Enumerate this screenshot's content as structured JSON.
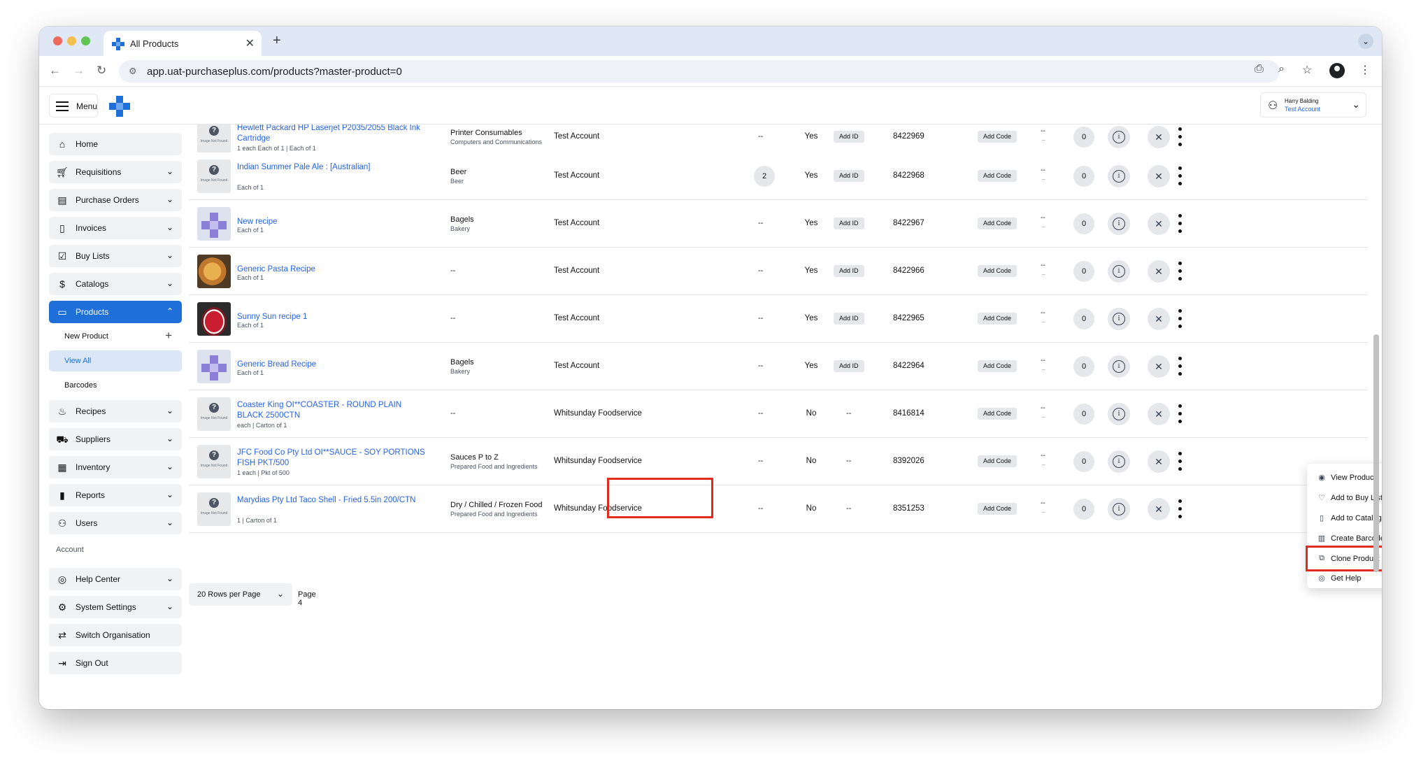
{
  "browser": {
    "tab_title": "All Products",
    "tab_close": "✕",
    "new_tab": "+",
    "tabs_menu": "⌄",
    "url": "app.uat-purchaseplus.com/products?master-product=0"
  },
  "header": {
    "menu_label": "Menu",
    "user_name": "Harry Balding",
    "user_org": "Test Account"
  },
  "sidebar": {
    "items": [
      {
        "label": "Home",
        "icon": "home-icon"
      },
      {
        "label": "Requisitions",
        "icon": "cart-icon"
      },
      {
        "label": "Purchase Orders",
        "icon": "clipboard-icon"
      },
      {
        "label": "Invoices",
        "icon": "invoice-icon"
      },
      {
        "label": "Buy Lists",
        "icon": "checklist-icon"
      },
      {
        "label": "Catalogs",
        "icon": "catalog-icon"
      },
      {
        "label": "Products",
        "icon": "box-icon"
      },
      {
        "label": "Recipes",
        "icon": "recipe-icon"
      },
      {
        "label": "Suppliers",
        "icon": "truck-icon"
      },
      {
        "label": "Inventory",
        "icon": "inventory-icon"
      },
      {
        "label": "Reports",
        "icon": "chart-icon"
      },
      {
        "label": "Users",
        "icon": "user-icon"
      }
    ],
    "products_sub": [
      "New Product",
      "View All",
      "Barcodes"
    ],
    "account_section": "Account",
    "account_items": [
      {
        "label": "Help Center",
        "icon": "lifebuoy-icon"
      },
      {
        "label": "System Settings",
        "icon": "gear-icon"
      },
      {
        "label": "Switch Organisation",
        "icon": "switch-icon"
      },
      {
        "label": "Sign Out",
        "icon": "signout-icon"
      }
    ]
  },
  "table": {
    "rows": [
      {
        "name": "Hewlett Packard HP Laserjet P2035/2055 Black Ink Cartridge",
        "unit": "1 each Each of 1 | Each of 1",
        "cat1": "Printer Consumables",
        "cat2": "Computers and Communications",
        "account": "Test Account",
        "col4": "--",
        "yesno": "Yes",
        "id_btn": "Add ID",
        "pid": "8422969",
        "code_btn": "Add Code",
        "dd": "--",
        "dd2": "--",
        "zero": "0",
        "thumb": "nf"
      },
      {
        "name": "Indian Summer Pale Ale : [Australian]",
        "unit": "Each of 1",
        "cat1": "Beer",
        "cat2": "Beer",
        "account": "Test Account",
        "col4": "2",
        "yesno": "Yes",
        "id_btn": "Add ID",
        "pid": "8422968",
        "code_btn": "Add Code",
        "dd": "--",
        "dd2": "--",
        "zero": "0",
        "thumb": "nf"
      },
      {
        "name": "New recipe",
        "unit": "Each of 1",
        "cat1": "Bagels",
        "cat2": "Bakery",
        "account": "Test Account",
        "col4": "--",
        "yesno": "Yes",
        "id_btn": "Add ID",
        "pid": "8422967",
        "code_btn": "Add Code",
        "dd": "--",
        "dd2": "--",
        "zero": "0",
        "thumb": "logo"
      },
      {
        "name": "Generic Pasta Recipe",
        "unit": "Each of 1",
        "cat1": "--",
        "cat2": "",
        "account": "Test Account",
        "col4": "--",
        "yesno": "Yes",
        "id_btn": "Add ID",
        "pid": "8422966",
        "code_btn": "Add Code",
        "dd": "--",
        "dd2": "--",
        "zero": "0",
        "thumb": "pasta"
      },
      {
        "name": "Sunny Sun recipe 1",
        "unit": "Each of 1",
        "cat1": "--",
        "cat2": "",
        "account": "Test Account",
        "col4": "--",
        "yesno": "Yes",
        "id_btn": "Add ID",
        "pid": "8422965",
        "code_btn": "Add Code",
        "dd": "--",
        "dd2": "--",
        "zero": "0",
        "thumb": "cake"
      },
      {
        "name": "Generic Bread Recipe",
        "unit": "Each of 1",
        "cat1": "Bagels",
        "cat2": "Bakery",
        "account": "Test Account",
        "col4": "--",
        "yesno": "Yes",
        "id_btn": "Add ID",
        "pid": "8422964",
        "code_btn": "Add Code",
        "dd": "--",
        "dd2": "--",
        "zero": "0",
        "thumb": "logo"
      },
      {
        "name": "Coaster King OI**COASTER - ROUND PLAIN BLACK 2500CTN",
        "unit": "each | Carton of 1",
        "cat1": "--",
        "cat2": "",
        "account": "Whitsunday Foodservice",
        "col4": "--",
        "yesno": "No",
        "id_btn": "--",
        "pid": "8416814",
        "code_btn": "Add Code",
        "dd": "--",
        "dd2": "--",
        "zero": "0",
        "thumb": "nf"
      },
      {
        "name": "JFC Food Co Pty Ltd OI**SAUCE - SOY PORTIONS FISH PKT/500",
        "unit": "1 each | Pkt of 500",
        "cat1": "Sauces P to Z",
        "cat2": "Prepared Food and Ingredients",
        "account": "Whitsunday Foodservice",
        "col4": "--",
        "yesno": "No",
        "id_btn": "--",
        "pid": "8392026",
        "code_btn": "Add Code",
        "dd": "--",
        "dd2": "--",
        "zero": "0",
        "thumb": "nf"
      },
      {
        "name": "Marydias Pty Ltd Taco Shell - Fried 5.5in 200/CTN",
        "unit": "1 | Carton of 1",
        "cat1": "Dry / Chilled / Frozen Food",
        "cat2": "Prepared Food and Ingredients",
        "account": "Whitsunday Foodservice",
        "col4": "--",
        "yesno": "No",
        "id_btn": "--",
        "pid": "8351253",
        "code_btn": "Add Code",
        "dd": "--",
        "dd2": "--",
        "zero": "0",
        "thumb": "nf"
      }
    ],
    "image_not_found": "Image Not Found"
  },
  "pagination": {
    "rows_per_page": "20 Rows per Page",
    "page": "Page 4"
  },
  "context_menu": {
    "items": [
      {
        "label": "View Product",
        "icon": "eye-icon"
      },
      {
        "label": "Add to Buy List",
        "icon": "heart-icon"
      },
      {
        "label": "Add to Catalog",
        "icon": "document-icon"
      },
      {
        "label": "Create Barcode",
        "icon": "barcode-icon"
      },
      {
        "label": "Clone Product",
        "icon": "clone-icon"
      },
      {
        "label": "Get Help",
        "icon": "lifebuoy-icon"
      }
    ]
  },
  "colors": {
    "accent": "#1f6fd8",
    "link": "#2563eb",
    "highlight": "#e02c1f"
  }
}
